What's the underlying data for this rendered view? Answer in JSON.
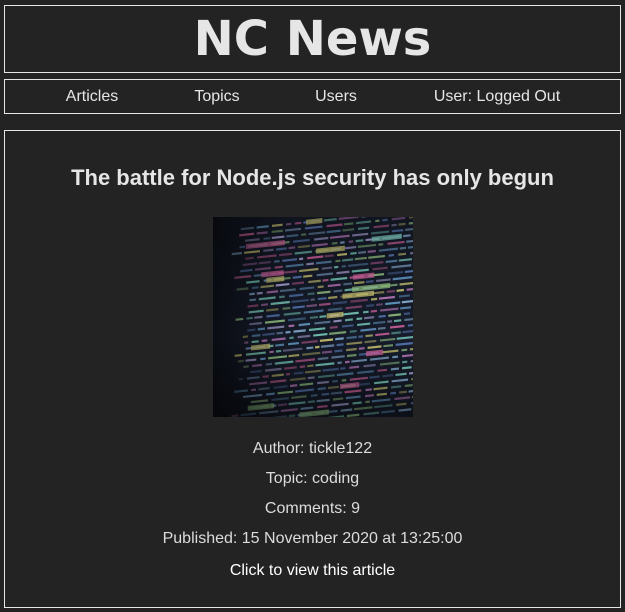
{
  "site": {
    "title": "NC News"
  },
  "nav": {
    "items": [
      {
        "label": "Articles"
      },
      {
        "label": "Topics"
      },
      {
        "label": "Users"
      }
    ],
    "user_status": "User: Logged Out"
  },
  "article": {
    "title": "The battle for Node.js security has only begun",
    "author": "Author: tickle122",
    "topic": "Topic: coding",
    "comments": "Comments: 9",
    "published": "Published: 15 November 2020 at 13:25:00",
    "view_link": "Click to view this article",
    "image_icon": "code-screen-photo"
  },
  "colors": {
    "background": "#232323",
    "text": "#e6e6e6",
    "border": "#e6e6e6"
  }
}
